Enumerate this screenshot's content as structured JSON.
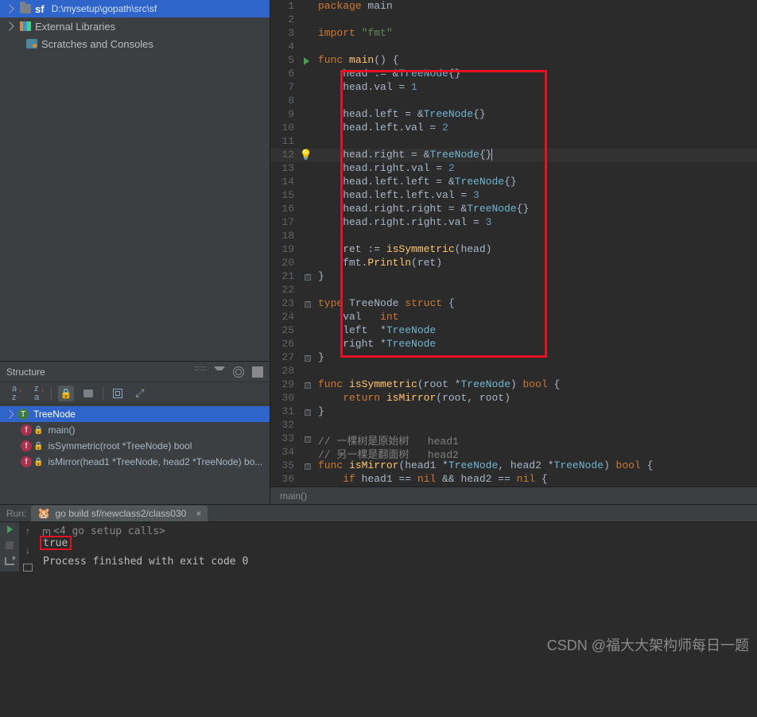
{
  "project": {
    "root_name": "sf",
    "root_path": "D:\\mysetup\\gopath\\src\\sf",
    "external_libs": "External Libraries",
    "scratches": "Scratches and Consoles"
  },
  "structure": {
    "title": "Structure",
    "items": [
      {
        "kind": "type",
        "label": "TreeNode",
        "has_children": true,
        "selected": true
      },
      {
        "kind": "func",
        "label": "main()",
        "locked": true
      },
      {
        "kind": "func",
        "label": "isSymmetric(root *TreeNode) bool",
        "locked": true
      },
      {
        "kind": "func",
        "label": "isMirror(head1 *TreeNode, head2 *TreeNode) bo...",
        "locked": true
      }
    ]
  },
  "editor": {
    "breadcrumb": "main()",
    "lines": [
      {
        "n": 1,
        "html": "<span class='kw'>package</span> main"
      },
      {
        "n": 2,
        "html": ""
      },
      {
        "n": 3,
        "html": "<span class='kw'>import</span> <span class='str'>\"fmt\"</span>"
      },
      {
        "n": 4,
        "html": ""
      },
      {
        "n": 5,
        "html": "<span class='kw'>func</span> <span class='fn'>main</span>() {",
        "run": true,
        "fold": true
      },
      {
        "n": 6,
        "html": "    head := &amp;<span class='type'>TreeNode</span>{}"
      },
      {
        "n": 7,
        "html": "    head.val = <span class='num'>1</span>"
      },
      {
        "n": 8,
        "html": ""
      },
      {
        "n": 9,
        "html": "    head.left = &amp;<span class='type'>TreeNode</span>{}"
      },
      {
        "n": 10,
        "html": "    head.left.val = <span class='num'>2</span>"
      },
      {
        "n": 11,
        "html": ""
      },
      {
        "n": 12,
        "html": "    head.right = &amp;<span class='type'>TreeNode</span><span class='cursor-caret'>{}</span>",
        "bulb": true,
        "current": true
      },
      {
        "n": 13,
        "html": "    head.right.val = <span class='num'>2</span>"
      },
      {
        "n": 14,
        "html": "    head.left.left = &amp;<span class='type'>TreeNode</span>{}"
      },
      {
        "n": 15,
        "html": "    head.left.left.val = <span class='num'>3</span>"
      },
      {
        "n": 16,
        "html": "    head.right.right = &amp;<span class='type'>TreeNode</span>{}"
      },
      {
        "n": 17,
        "html": "    head.right.right.val = <span class='num'>3</span>"
      },
      {
        "n": 18,
        "html": ""
      },
      {
        "n": 19,
        "html": "    ret := <span class='fn'>isSymmetric</span>(head)"
      },
      {
        "n": 20,
        "html": "    fmt.<span class='fn'>Println</span>(ret)"
      },
      {
        "n": 21,
        "html": "}",
        "fold": true
      },
      {
        "n": 22,
        "html": ""
      },
      {
        "n": 23,
        "html": "<span class='kw'>type</span> TreeNode <span class='kw'>struct</span> {",
        "fold": true
      },
      {
        "n": 24,
        "html": "    val   <span class='kw'>int</span>"
      },
      {
        "n": 25,
        "html": "    left  *<span class='type'>TreeNode</span>"
      },
      {
        "n": 26,
        "html": "    right *<span class='type'>TreeNode</span>"
      },
      {
        "n": 27,
        "html": "}",
        "fold": true
      },
      {
        "n": 28,
        "html": ""
      },
      {
        "n": 29,
        "html": "<span class='kw'>func</span> <span class='fn'>isSymmetric</span>(root *<span class='type'>TreeNode</span>) <span class='kw'>bool</span> {",
        "fold": true
      },
      {
        "n": 30,
        "html": "    <span class='kw'>return</span> <span class='fn'>isMirror</span>(root, root)"
      },
      {
        "n": 31,
        "html": "}",
        "fold": true
      },
      {
        "n": 32,
        "html": ""
      },
      {
        "n": 33,
        "html": "<span class='comment'>// 一棵树是原始树   head1</span>",
        "fold": true
      },
      {
        "n": 34,
        "html": "<span class='comment'>// 另一棵是翻面树   head2</span>"
      },
      {
        "n": 35,
        "html": "<span class='kw'>func</span> <span class='fn'>isMirror</span>(head1 *<span class='type'>TreeNode</span>, head2 *<span class='type'>TreeNode</span>) <span class='kw'>bool</span> {",
        "fold": true
      },
      {
        "n": 36,
        "html": "    <span class='kw'>if</span> head1 == <span class='kw'>nil</span> &amp;&amp; head2 == <span class='kw'>nil</span> {"
      }
    ]
  },
  "run": {
    "label": "Run:",
    "tab": "go build sf/newclass2/class030",
    "setup": "<4 go setup calls>",
    "output": "true",
    "exit": "Process finished with exit code 0"
  },
  "watermark": "CSDN @福大大架构师每日一题"
}
